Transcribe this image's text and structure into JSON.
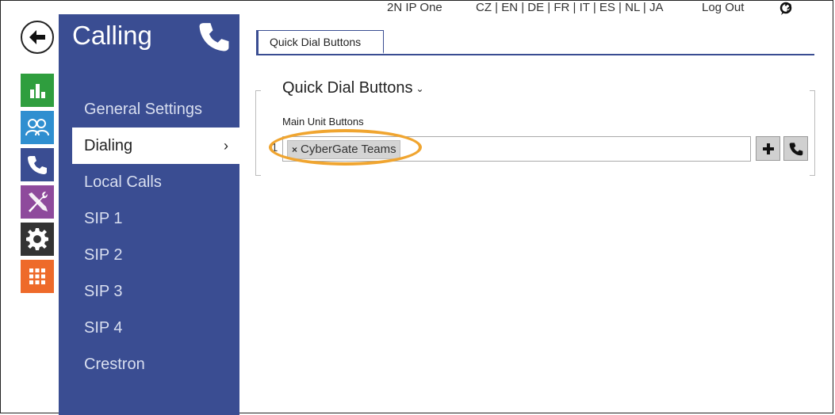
{
  "topbar": {
    "device_name": "2N IP One",
    "languages": "CZ | EN | DE | FR | IT | ES | NL | JA",
    "logout_label": "Log Out",
    "help_label": "?"
  },
  "rail": {
    "items": [
      {
        "icon": "status-chart-icon",
        "color": "#2f9e3e"
      },
      {
        "icon": "directory-users-icon",
        "color": "#2f8fd0"
      },
      {
        "icon": "calling-phone-icon",
        "color": "#3a4d92"
      },
      {
        "icon": "hardware-tools-icon",
        "color": "#8e4a9c"
      },
      {
        "icon": "services-gear-icon",
        "color": "#333333"
      },
      {
        "icon": "system-grid-icon",
        "color": "#ee6a2a"
      }
    ]
  },
  "sidebar": {
    "title": "Calling",
    "items": [
      {
        "label": "General Settings"
      },
      {
        "label": "Dialing",
        "active": true,
        "chevron": "›"
      },
      {
        "label": "Local Calls"
      },
      {
        "label": "SIP 1"
      },
      {
        "label": "SIP 2"
      },
      {
        "label": "SIP 3"
      },
      {
        "label": "SIP 4"
      },
      {
        "label": "Crestron"
      }
    ]
  },
  "main": {
    "tabs": [
      {
        "label": "Quick Dial Buttons"
      }
    ],
    "section_title": "Quick Dial Buttons",
    "field_label": "Main Unit Buttons",
    "rows": [
      {
        "number": "1",
        "chip": "CyberGate Teams",
        "chip_remove": "×"
      }
    ]
  },
  "colors": {
    "sidebar_bg": "#3a4d92",
    "highlight": "#f0a530"
  }
}
